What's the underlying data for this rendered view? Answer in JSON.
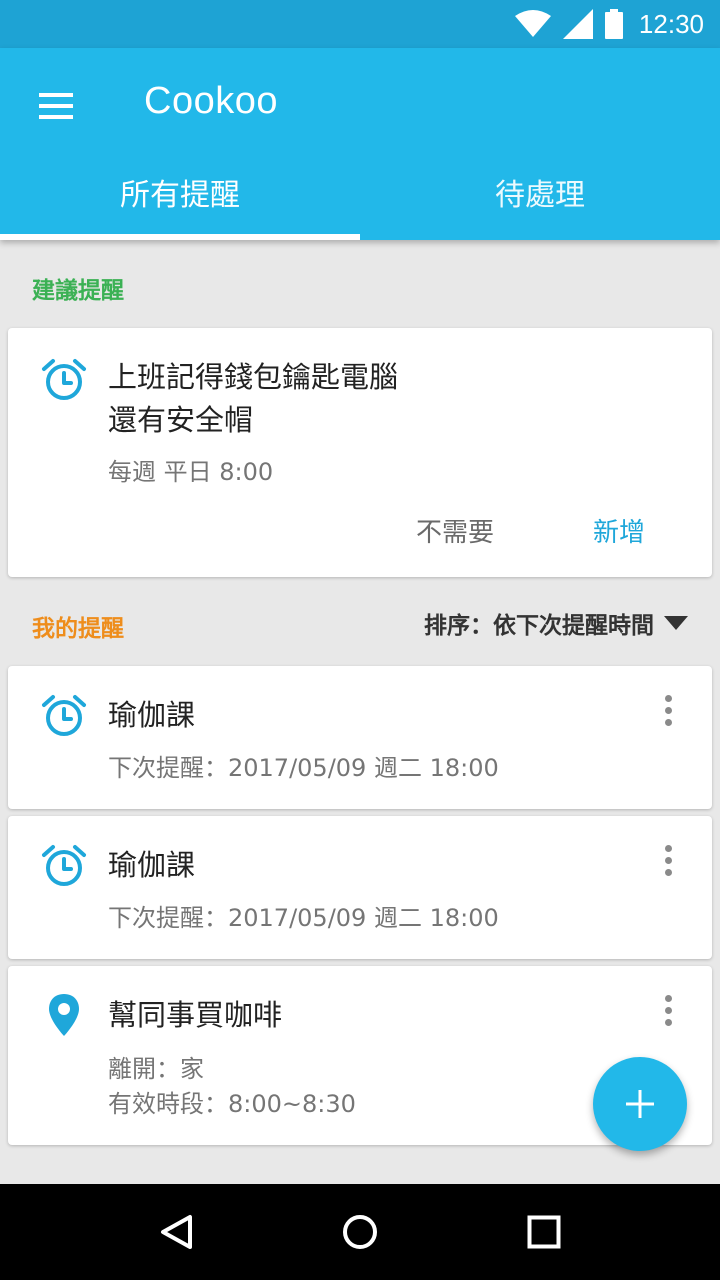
{
  "status_bar": {
    "time": "12:30",
    "icons": [
      "wifi-icon",
      "signal-icon",
      "battery-icon"
    ]
  },
  "app": {
    "title": "Cookoo",
    "menu_icon": "hamburger-menu-icon"
  },
  "tabs": [
    {
      "label": "所有提醒",
      "selected": true
    },
    {
      "label": "待處理",
      "selected": false
    }
  ],
  "suggested": {
    "section_label": "建議提醒",
    "card": {
      "icon": "alarm-clock-icon",
      "title_line1": "上班記得錢包鑰匙電腦",
      "title_line2": "還有安全帽",
      "schedule": "每週 平日 8:00",
      "dismiss_label": "不需要",
      "add_label": "新增"
    }
  },
  "my_reminders": {
    "section_label": "我的提醒",
    "sort_label": "排序：依下次提醒時間",
    "items": [
      {
        "icon": "alarm-clock-icon",
        "title": "瑜伽課",
        "line1": "下次提醒：2017/05/09 週二 18:00"
      },
      {
        "icon": "alarm-clock-icon",
        "title": "瑜伽課",
        "line1": "下次提醒：2017/05/09 週二 18:00"
      },
      {
        "icon": "location-pin-icon",
        "title": "幫同事買咖啡",
        "line1": "離開：家",
        "line2": "有效時段：8:00~8:30"
      }
    ]
  },
  "fab": {
    "icon": "plus-icon"
  },
  "nav": {
    "icons": [
      "back-icon",
      "home-icon",
      "recents-icon"
    ]
  },
  "colors": {
    "primary": "#22b8e9",
    "status_bar": "#1ea3d4",
    "accent_green": "#3bb154",
    "accent_orange": "#ee8d1c",
    "icon_blue": "#1fa7da"
  }
}
